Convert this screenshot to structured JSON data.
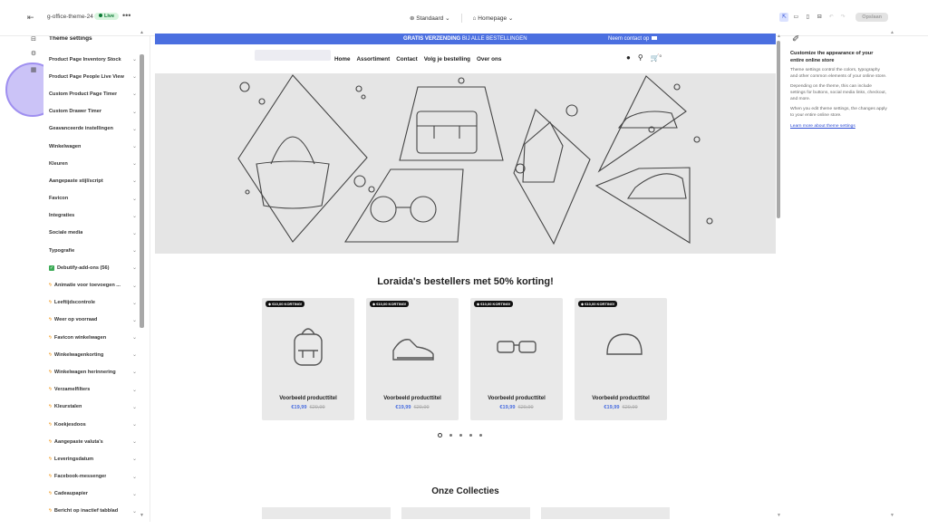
{
  "topbar": {
    "exit_icon": "exit-icon",
    "theme_name": "g-office-theme-24",
    "live_badge": "Live",
    "more": "•••",
    "view_mode": "Standaard",
    "page_select": "Homepage",
    "save_label": "Opslaan"
  },
  "sidebar": {
    "title": "Theme settings",
    "items": [
      {
        "label": "Product Page Inventory Stock"
      },
      {
        "label": "Product Page People Live View"
      },
      {
        "label": "Custom Product Page Timer"
      },
      {
        "label": "Custom Drawer Timer"
      },
      {
        "label": "Geavanceerde instellingen"
      },
      {
        "label": "Winkelwagen"
      },
      {
        "label": "Kleuren"
      },
      {
        "label": "Aangepaste stijl/script"
      },
      {
        "label": "Favicon"
      },
      {
        "label": "Integraties"
      },
      {
        "label": "Sociale media"
      },
      {
        "label": "Typografie"
      },
      {
        "label": "Debutify-add-ons (56)",
        "prefix": "check"
      },
      {
        "label": "Animatie voor toevoegen ...",
        "prefix": "bolt"
      },
      {
        "label": "Leeftijdscontrole",
        "prefix": "bolt"
      },
      {
        "label": "Weer op voorraad",
        "prefix": "bolt"
      },
      {
        "label": "Favicon winkelwagen",
        "prefix": "bolt"
      },
      {
        "label": "Winkelwagenkorting",
        "prefix": "bolt"
      },
      {
        "label": "Winkelwagen herinnering",
        "prefix": "bolt"
      },
      {
        "label": "Verzamelfilters",
        "prefix": "bolt"
      },
      {
        "label": "Kleurstalen",
        "prefix": "bolt"
      },
      {
        "label": "Koekjesdoos",
        "prefix": "bolt"
      },
      {
        "label": "Aangepaste valuta's",
        "prefix": "bolt"
      },
      {
        "label": "Leveringsdatum",
        "prefix": "bolt"
      },
      {
        "label": "Facebook-messenger",
        "prefix": "bolt"
      },
      {
        "label": "Cadeaupapier",
        "prefix": "bolt"
      },
      {
        "label": "Bericht op inactief tabblad",
        "prefix": "bolt"
      }
    ]
  },
  "preview": {
    "announcement": {
      "bold": "GRATIS VERZENDING",
      "rest": " BIJ ALLE BESTELLINGEN",
      "contact": "Neem contact op"
    },
    "nav": [
      "Home",
      "Assortiment",
      "Contact",
      "Volg je bestelling",
      "Over ons"
    ],
    "cart_count": "0",
    "bestsellers_title": "Loraida's bestellers met 50% korting!",
    "products": [
      {
        "badge": "€10,00 KORTING!",
        "title": "Voorbeeld producttitel",
        "price": "€19,99",
        "compare": "€29,99",
        "icon": "backpack-icon"
      },
      {
        "badge": "€10,00 KORTING!",
        "title": "Voorbeeld producttitel",
        "price": "€19,99",
        "compare": "€29,99",
        "icon": "sneaker-icon"
      },
      {
        "badge": "€10,00 KORTING!",
        "title": "Voorbeeld producttitel",
        "price": "€19,99",
        "compare": "€29,99",
        "icon": "sunglasses-icon"
      },
      {
        "badge": "€10,00 KORTING!",
        "title": "Voorbeeld producttitel",
        "price": "€19,99",
        "compare": "€29,99",
        "icon": "cap-icon"
      }
    ],
    "collections_title": "Onze Collecties",
    "accent": "#4b6fe0"
  },
  "rpanel": {
    "title": "Customize the appearance of your entire online store",
    "p1": "Theme settings control the colors, typography and other common elements of your online store.",
    "p2": "Depending on the theme, this can include settings for buttons, social media links, checkout, and more.",
    "p3": "When you edit theme settings, the changes apply to your entire online store.",
    "link": "Learn more about theme settings"
  }
}
